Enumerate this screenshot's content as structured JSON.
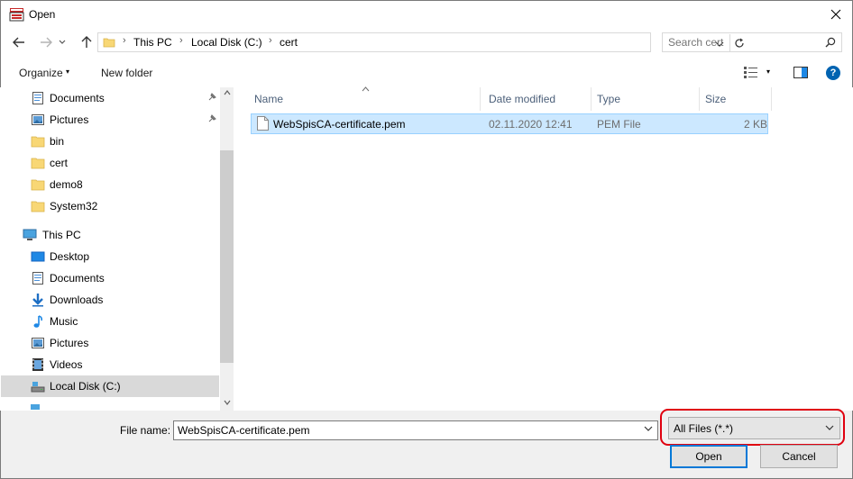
{
  "window": {
    "title": "Open",
    "close_glyph": "✕"
  },
  "nav_buttons": {
    "back": "←",
    "forward": "→",
    "up": "↑",
    "recent": "⌄"
  },
  "address": {
    "crumbs": [
      "This PC",
      "Local Disk (C:)",
      "cert"
    ],
    "separator": "›",
    "dropdown_glyph": "⌄"
  },
  "search": {
    "placeholder": "Search cert"
  },
  "toolbar": {
    "organize_label": "Organize",
    "new_folder_label": "New folder",
    "dropdown_glyph": "▾",
    "help_glyph": "?"
  },
  "nav_pane": {
    "items": [
      {
        "label": "Documents",
        "icon": "documents-icon",
        "pinned": true
      },
      {
        "label": "Pictures",
        "icon": "pictures-icon",
        "pinned": true
      },
      {
        "label": "bin",
        "icon": "folder-icon"
      },
      {
        "label": "cert",
        "icon": "folder-icon"
      },
      {
        "label": "demo8",
        "icon": "folder-icon"
      },
      {
        "label": "System32",
        "icon": "folder-icon"
      },
      {
        "label": "This PC",
        "icon": "pc-icon"
      },
      {
        "label": "Desktop",
        "icon": "desktop-icon"
      },
      {
        "label": "Documents",
        "icon": "documents-icon"
      },
      {
        "label": "Downloads",
        "icon": "downloads-icon"
      },
      {
        "label": "Music",
        "icon": "music-icon"
      },
      {
        "label": "Pictures",
        "icon": "pictures-icon"
      },
      {
        "label": "Videos",
        "icon": "videos-icon"
      },
      {
        "label": "Local Disk (C:)",
        "icon": "drive-icon",
        "selected": true
      }
    ]
  },
  "columns": {
    "name": "Name",
    "date": "Date modified",
    "type": "Type",
    "size": "Size"
  },
  "files": [
    {
      "name": "WebSpisCA-certificate.pem",
      "date": "02.11.2020 12:41",
      "type": "PEM File",
      "size": "2 KB",
      "selected": true
    }
  ],
  "bottom": {
    "file_name_label": "File name:",
    "file_name_value": "WebSpisCA-certificate.pem",
    "filter_value": "All Files (*.*)",
    "open_label": "Open",
    "cancel_label": "Cancel",
    "highlight_color": "#e0000f"
  },
  "colors": {
    "selection": "#cce8ff",
    "accent": "#0078d7",
    "header_text": "#4c607a"
  }
}
